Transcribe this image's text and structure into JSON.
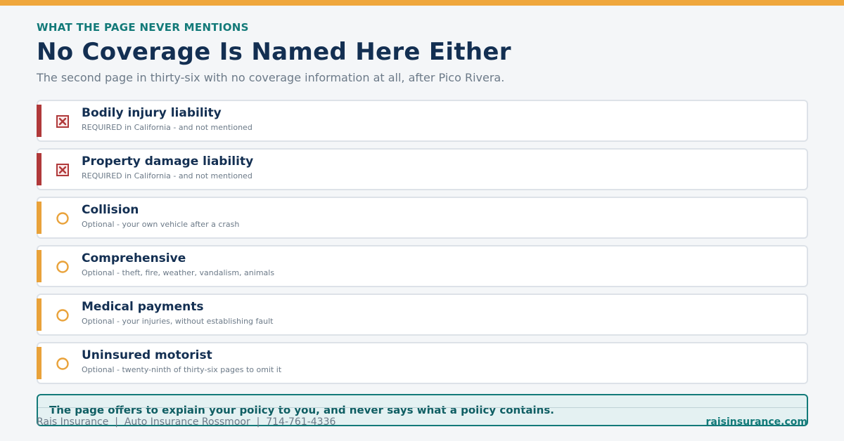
{
  "header": {
    "eyebrow": "WHAT THE PAGE NEVER MENTIONS",
    "title": "No Coverage Is Named Here Either",
    "subtitle": "The second page in thirty-six with no coverage information at all, after Pico Rivera."
  },
  "coverages": [
    {
      "name": "Bodily injury liability",
      "note": "REQUIRED in California - and not mentioned",
      "status": "required",
      "icon": "x-box-icon"
    },
    {
      "name": "Property damage liability",
      "note": "REQUIRED in California - and not mentioned",
      "status": "required",
      "icon": "x-box-icon"
    },
    {
      "name": "Collision",
      "note": "Optional - your own vehicle after a crash",
      "status": "optional",
      "icon": "circle-icon"
    },
    {
      "name": "Comprehensive",
      "note": "Optional - theft, fire, weather, vandalism, animals",
      "status": "optional",
      "icon": "circle-icon"
    },
    {
      "name": "Medical payments",
      "note": "Optional - your injuries, without establishing fault",
      "status": "optional",
      "icon": "circle-icon"
    },
    {
      "name": "Uninsured motorist",
      "note": "Optional - twenty-ninth of thirty-six pages to omit it",
      "status": "optional",
      "icon": "circle-icon"
    }
  ],
  "callout": {
    "text": "The page offers to explain your policy to you, and never says what a policy contains."
  },
  "footer": {
    "left": "Rais Insurance  |  Auto Insurance Rossmoor  |  714-761-4336",
    "right": "raisinsurance.com"
  },
  "colors": {
    "accent_orange": "#efa73d",
    "required_red": "#b0393a",
    "optional_orange": "#e9a23a",
    "teal": "#137a79",
    "navy": "#132f52"
  }
}
